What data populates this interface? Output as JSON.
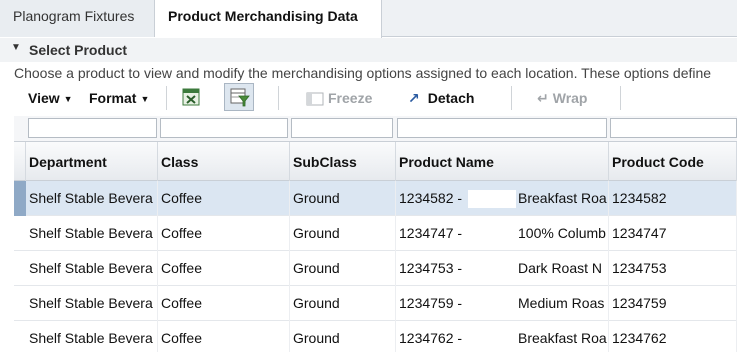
{
  "tabs": [
    {
      "label": "Planogram Fixtures",
      "active": false
    },
    {
      "label": "Product Merchandising Data",
      "active": true
    }
  ],
  "section": {
    "title": "Select Product",
    "description": "Choose a product to view and modify the merchandising options assigned to each location. These options define"
  },
  "toolbar": {
    "view_label": "View",
    "format_label": "Format",
    "freeze_label": "Freeze",
    "detach_label": "Detach",
    "wrap_label": "Wrap",
    "icons": [
      "export-excel-icon",
      "query-by-example-icon",
      "freeze-icon",
      "detach-icon",
      "wrap-icon"
    ]
  },
  "grid": {
    "columns": [
      {
        "key": "department",
        "label": "Department"
      },
      {
        "key": "class",
        "label": "Class"
      },
      {
        "key": "subclass",
        "label": "SubClass"
      },
      {
        "key": "product_name",
        "label": "Product Name"
      },
      {
        "key": "product_code",
        "label": "Product Code"
      }
    ],
    "rows": [
      {
        "department": "Shelf Stable Bevera",
        "class": "Coffee",
        "subclass": "Ground",
        "code_prefix": "1234582 -",
        "name_suffix": "Breakfast Roa",
        "product_code": "1234582",
        "selected": true
      },
      {
        "department": "Shelf Stable Bevera",
        "class": "Coffee",
        "subclass": "Ground",
        "code_prefix": "1234747 -",
        "name_suffix": "100% Columb",
        "product_code": "1234747",
        "selected": false
      },
      {
        "department": "Shelf Stable Bevera",
        "class": "Coffee",
        "subclass": "Ground",
        "code_prefix": "1234753 -",
        "name_suffix": "Dark Roast N",
        "product_code": "1234753",
        "selected": false
      },
      {
        "department": "Shelf Stable Bevera",
        "class": "Coffee",
        "subclass": "Ground",
        "code_prefix": "1234759 -",
        "name_suffix": "Medium Roas",
        "product_code": "1234759",
        "selected": false
      },
      {
        "department": "Shelf Stable Bevera",
        "class": "Coffee",
        "subclass": "Ground",
        "code_prefix": "1234762 -",
        "name_suffix": "Breakfast Roa",
        "product_code": "1234762",
        "selected": false
      }
    ]
  },
  "colors": {
    "selected_row": "#dbe6f2",
    "row_marker": "#8fa9c6",
    "tab_bar": "#eef1f4"
  }
}
